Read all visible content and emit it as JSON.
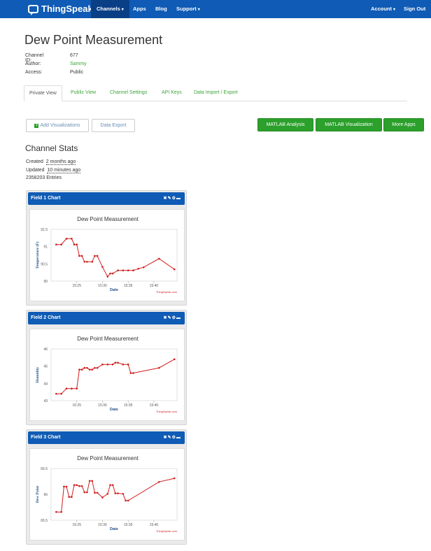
{
  "nav": {
    "brand": "ThingSpeak",
    "items": [
      "Channels",
      "Apps",
      "Blog",
      "Support"
    ],
    "right": [
      "Account",
      "Sign Out"
    ],
    "colors": {
      "bar": "#0f5bb5",
      "active": "#0a3f86"
    }
  },
  "page": {
    "title": "Dew Point Measurement",
    "meta": [
      {
        "label": "Channel ID:",
        "value": "677"
      },
      {
        "label": "Author:",
        "value": "Sammy"
      },
      {
        "label": "Access:",
        "value": "Public"
      }
    ]
  },
  "tabs": [
    "Private View",
    "Public View",
    "Channel Settings",
    "API Keys",
    "Data Import / Export"
  ],
  "toolbar": {
    "add": "Add Visualizations",
    "export": "Data Export",
    "matlab_analysis": "MATLAB Analysis",
    "matlab_viz": "MATLAB Visualization",
    "more_apps": "More Apps"
  },
  "stats": {
    "heading": "Channel Stats",
    "created_label": "Created",
    "created_value": "2 months ago",
    "updated_label": "Updated",
    "updated_value": "10 minutes ago",
    "entries": "2358203 Entries"
  },
  "cards": [
    {
      "header": "Field 1 Chart"
    },
    {
      "header": "Field 2 Chart"
    },
    {
      "header": "Field 3 Chart"
    }
  ],
  "icons": [
    "close-icon",
    "edit-icon",
    "gear-icon",
    "minus-icon",
    "plus-icon",
    "chat-logo-icon",
    "chevron-down-icon"
  ],
  "chart_data": [
    {
      "type": "line",
      "title": "Dew Point Measurement",
      "xlabel": "Date",
      "ylabel": "Temperature (F)",
      "credit": "ThingSpeak.com",
      "xticks": [
        "15:25",
        "15:30",
        "15:35",
        "15:40"
      ],
      "yticks": [
        "90",
        "90.5",
        "91",
        "91.5"
      ],
      "ylim": [
        90,
        91.5
      ],
      "color": "#d01e1e",
      "series": [
        {
          "values": [
            [
              15.21,
              91.06
            ],
            [
              15.22,
              91.06
            ],
            [
              15.23,
              91.23
            ],
            [
              15.24,
              91.23
            ],
            [
              15.245,
              91.06
            ],
            [
              15.25,
              91.06
            ],
            [
              15.255,
              90.73
            ],
            [
              15.26,
              90.73
            ],
            [
              15.265,
              90.56
            ],
            [
              15.27,
              90.56
            ],
            [
              15.28,
              90.56
            ],
            [
              15.285,
              90.73
            ],
            [
              15.29,
              90.73
            ],
            [
              15.3,
              90.41
            ],
            [
              15.31,
              90.13
            ],
            [
              15.315,
              90.22
            ],
            [
              15.32,
              90.22
            ],
            [
              15.33,
              90.31
            ],
            [
              15.34,
              90.31
            ],
            [
              15.35,
              90.31
            ],
            [
              15.36,
              90.31
            ],
            [
              15.37,
              90.36
            ],
            [
              15.38,
              90.4
            ],
            [
              15.41,
              90.65
            ],
            [
              15.44,
              90.34
            ]
          ]
        }
      ]
    },
    {
      "type": "line",
      "title": "Dew Point Measurement",
      "xlabel": "Date",
      "ylabel": "Humidity",
      "credit": "ThingSpeak.com",
      "xticks": [
        "15:25",
        "15:30",
        "15:35",
        "15:40"
      ],
      "yticks": [
        "43",
        "44",
        "45",
        "46"
      ],
      "ylim": [
        43,
        46
      ],
      "color": "#d01e1e",
      "series": [
        {
          "values": [
            [
              15.21,
              43.4
            ],
            [
              15.22,
              43.4
            ],
            [
              15.23,
              43.7
            ],
            [
              15.24,
              43.7
            ],
            [
              15.25,
              43.7
            ],
            [
              15.255,
              44.8
            ],
            [
              15.26,
              44.8
            ],
            [
              15.265,
              44.9
            ],
            [
              15.27,
              44.9
            ],
            [
              15.275,
              44.8
            ],
            [
              15.28,
              44.8
            ],
            [
              15.285,
              44.9
            ],
            [
              15.29,
              44.9
            ],
            [
              15.3,
              45.1
            ],
            [
              15.31,
              45.1
            ],
            [
              15.32,
              45.1
            ],
            [
              15.325,
              45.2
            ],
            [
              15.33,
              45.2
            ],
            [
              15.34,
              45.1
            ],
            [
              15.35,
              45.1
            ],
            [
              15.355,
              44.6
            ],
            [
              15.36,
              44.6
            ],
            [
              15.41,
              44.9
            ],
            [
              15.44,
              45.4
            ]
          ]
        }
      ]
    },
    {
      "type": "line",
      "title": "Dew Point Measurement",
      "xlabel": "Date",
      "ylabel": "Dew Point",
      "credit": "ThingSpeak.com",
      "xticks": [
        "15:25",
        "15:30",
        "15:35",
        "15:40"
      ],
      "yticks": [
        "65.5",
        "66",
        "66.5"
      ],
      "ylim": [
        65.5,
        66.5
      ],
      "color": "#d01e1e",
      "series": [
        {
          "values": [
            [
              15.21,
              65.66
            ],
            [
              15.22,
              65.66
            ],
            [
              15.225,
              66.15
            ],
            [
              15.23,
              66.15
            ],
            [
              15.235,
              65.95
            ],
            [
              15.24,
              65.95
            ],
            [
              15.245,
              66.18
            ],
            [
              15.25,
              66.18
            ],
            [
              15.255,
              66.16
            ],
            [
              15.26,
              66.16
            ],
            [
              15.265,
              66.04
            ],
            [
              15.27,
              66.04
            ],
            [
              15.275,
              66.26
            ],
            [
              15.28,
              66.26
            ],
            [
              15.285,
              66.03
            ],
            [
              15.29,
              66.03
            ],
            [
              15.3,
              65.94
            ],
            [
              15.31,
              66.01
            ],
            [
              15.315,
              66.18
            ],
            [
              15.32,
              66.18
            ],
            [
              15.325,
              66.02
            ],
            [
              15.33,
              66.02
            ],
            [
              15.34,
              66.01
            ],
            [
              15.345,
              65.88
            ],
            [
              15.35,
              65.88
            ],
            [
              15.41,
              66.24
            ],
            [
              15.44,
              66.31
            ]
          ]
        }
      ]
    }
  ]
}
